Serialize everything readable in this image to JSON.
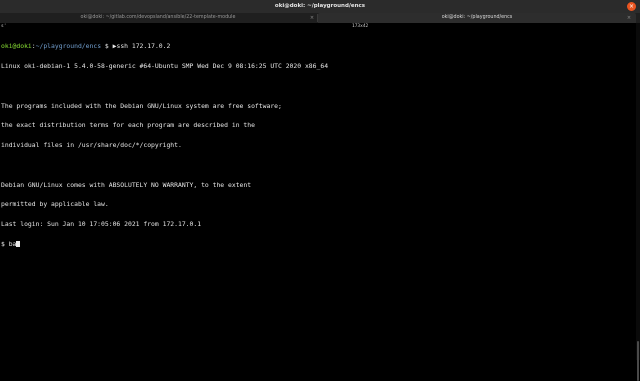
{
  "window": {
    "title": "oki@doki: ~/playground/encs",
    "close_icon": "×"
  },
  "tabs": [
    {
      "label": "oki@doki: ~/gitlab.com/devopsland/ansible/22-template-module",
      "close": "×",
      "active": false
    },
    {
      "label": "oki@doki: ~/playground/encs",
      "close": "×",
      "active": true
    }
  ],
  "size_indicator": "173x42",
  "corner_glyph": "s'",
  "terminal": {
    "prompt_user": "oki@doki",
    "prompt_path": "~/playground/encs",
    "prompt_symbol": " $ ",
    "prompt_arrow": "▶",
    "command": "ssh 172.17.0.2",
    "lines": [
      "Linux oki-debian-1 5.4.0-58-generic #64-Ubuntu SMP Wed Dec 9 08:16:25 UTC 2020 x86_64",
      "",
      "The programs included with the Debian GNU/Linux system are free software;",
      "the exact distribution terms for each program are described in the",
      "individual files in /usr/share/doc/*/copyright.",
      "",
      "Debian GNU/Linux comes with ABSOLUTELY NO WARRANTY, to the extent",
      "permitted by applicable law.",
      "Last login: Sun Jan 10 17:05:06 2021 from 172.17.0.1"
    ],
    "current_input": "$ ba"
  },
  "colors": {
    "background": "#000000",
    "prompt_user": "#8ae234",
    "prompt_path": "#729fcf",
    "text": "#e8e8e8",
    "close_accent": "#e95420"
  }
}
